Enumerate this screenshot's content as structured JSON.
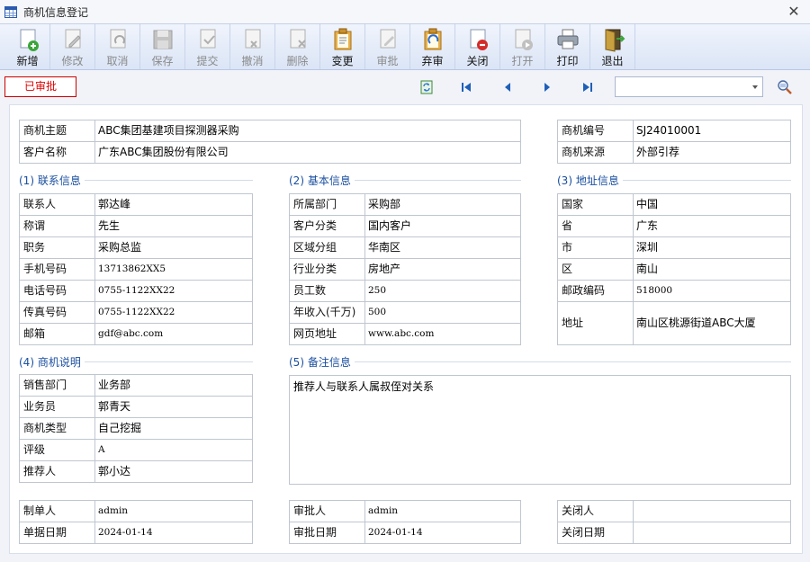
{
  "window": {
    "title": "商机信息登记",
    "close_symbol": "✕"
  },
  "toolbar": [
    {
      "key": "new",
      "label": "新增",
      "icon": "new-doc-icon",
      "enabled": true
    },
    {
      "key": "edit",
      "label": "修改",
      "icon": "edit-pencil-icon",
      "enabled": false
    },
    {
      "key": "cancel",
      "label": "取消",
      "icon": "undo-doc-icon",
      "enabled": false
    },
    {
      "key": "save",
      "label": "保存",
      "icon": "floppy-disk-icon",
      "enabled": false
    },
    {
      "key": "submit",
      "label": "提交",
      "icon": "submit-doc-icon",
      "enabled": false
    },
    {
      "key": "revoke",
      "label": "撤消",
      "icon": "revoke-doc-icon",
      "enabled": false
    },
    {
      "key": "delete",
      "label": "删除",
      "icon": "delete-doc-icon",
      "enabled": false
    },
    {
      "key": "change",
      "label": "变更",
      "icon": "clipboard-icon",
      "enabled": true
    },
    {
      "key": "approve",
      "label": "审批",
      "icon": "approve-doc-icon",
      "enabled": false
    },
    {
      "key": "abandon",
      "label": "弃审",
      "icon": "abandon-clipboard-icon",
      "enabled": true
    },
    {
      "key": "close",
      "label": "关闭",
      "icon": "close-doc-red-icon",
      "enabled": true
    },
    {
      "key": "open",
      "label": "打开",
      "icon": "open-doc-play-icon",
      "enabled": false
    },
    {
      "key": "print",
      "label": "打印",
      "icon": "printer-icon",
      "enabled": true
    },
    {
      "key": "exit",
      "label": "退出",
      "icon": "exit-door-icon",
      "enabled": true
    }
  ],
  "status": {
    "label": "已审批",
    "color": "#dd0000"
  },
  "nav": {
    "search_value": ""
  },
  "header": {
    "subject_label": "商机主题",
    "subject": "ABC集团基建项目探测器采购",
    "customer_label": "客户名称",
    "customer": "广东ABC集团股份有限公司",
    "code_label": "商机编号",
    "code": "SJ24010001",
    "source_label": "商机来源",
    "source": "外部引荐"
  },
  "contact": {
    "title": "(1) 联系信息",
    "rows": [
      {
        "label": "联系人",
        "value": "郭达峰"
      },
      {
        "label": "称谓",
        "value": "先生"
      },
      {
        "label": "职务",
        "value": "采购总监"
      },
      {
        "label": "手机号码",
        "value": "13713862XX5"
      },
      {
        "label": "电话号码",
        "value": "0755-1122XX22"
      },
      {
        "label": "传真号码",
        "value": "0755-1122XX22"
      },
      {
        "label": "邮箱",
        "value": "gdf@abc.com"
      }
    ]
  },
  "basic": {
    "title": "(2) 基本信息",
    "rows": [
      {
        "label": "所属部门",
        "value": "采购部"
      },
      {
        "label": "客户分类",
        "value": "国内客户"
      },
      {
        "label": "区域分组",
        "value": "华南区"
      },
      {
        "label": "行业分类",
        "value": "房地产"
      },
      {
        "label": "员工数",
        "value": "250"
      },
      {
        "label": "年收入(千万)",
        "value": "500"
      },
      {
        "label": "网页地址",
        "value": "www.abc.com"
      }
    ]
  },
  "address": {
    "title": "(3) 地址信息",
    "rows": [
      {
        "label": "国家",
        "value": "中国"
      },
      {
        "label": "省",
        "value": "广东"
      },
      {
        "label": "市",
        "value": "深圳"
      },
      {
        "label": "区",
        "value": "南山"
      },
      {
        "label": "邮政编码",
        "value": "518000"
      }
    ],
    "addr_label": "地址",
    "addr": "南山区桃源街道ABC大厦"
  },
  "desc": {
    "title": "(4) 商机说明",
    "rows": [
      {
        "label": "销售部门",
        "value": "业务部"
      },
      {
        "label": "业务员",
        "value": "郭青天"
      },
      {
        "label": "商机类型",
        "value": "自己挖掘"
      },
      {
        "label": "评级",
        "value": "A"
      },
      {
        "label": "推荐人",
        "value": "郭小达"
      }
    ]
  },
  "remark": {
    "title": "(5) 备注信息",
    "text": "推荐人与联系人属叔侄对关系"
  },
  "footer": {
    "maker_label": "制单人",
    "maker": "admin",
    "doc_date_label": "单据日期",
    "doc_date": "2024-01-14",
    "approver_label": "审批人",
    "approver": "admin",
    "approve_date_label": "审批日期",
    "approve_date": "2024-01-14",
    "closer_label": "关闭人",
    "closer": "",
    "close_date_label": "关闭日期",
    "close_date": ""
  }
}
